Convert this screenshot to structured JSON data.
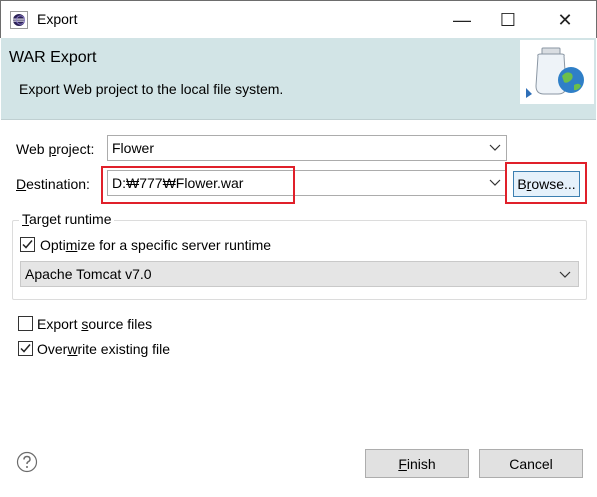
{
  "window": {
    "title": "Export",
    "minimize_glyph": "—",
    "maximize_glyph": "☐",
    "close_glyph": "✕",
    "app_icon": "eclipse-icon"
  },
  "banner": {
    "title": "WAR Export",
    "description": "Export Web project to the local file system.",
    "image_icon": "war-export-wizard-icon"
  },
  "form": {
    "web_project_label_pre": "Web ",
    "web_project_label_u": "p",
    "web_project_label_post": "roject:",
    "web_project_value": "Flower",
    "destination_label_pre": "",
    "destination_label_u": "D",
    "destination_label_post": "estination:",
    "destination_value": "D:₩777₩Flower.war",
    "browse_label_pre": "B",
    "browse_label_u": "r",
    "browse_label_post": "owse...",
    "highlight_color": "#e0202a"
  },
  "target_runtime": {
    "group_label_u": "T",
    "group_label_post": "arget runtime",
    "optimize_label_pre": "Opti",
    "optimize_label_u": "m",
    "optimize_label_post": "ize for a specific server runtime",
    "optimize_checked": true,
    "runtime_value": "Apache Tomcat v7.0"
  },
  "options": {
    "export_source_pre": "Export ",
    "export_source_u": "s",
    "export_source_post": "ource files",
    "export_source_checked": false,
    "overwrite_pre": "Over",
    "overwrite_u": "w",
    "overwrite_post": "rite existing file",
    "overwrite_checked": true
  },
  "footer": {
    "help_icon": "help-icon",
    "finish_u": "F",
    "finish_post": "inish",
    "cancel_label": "Cancel"
  }
}
